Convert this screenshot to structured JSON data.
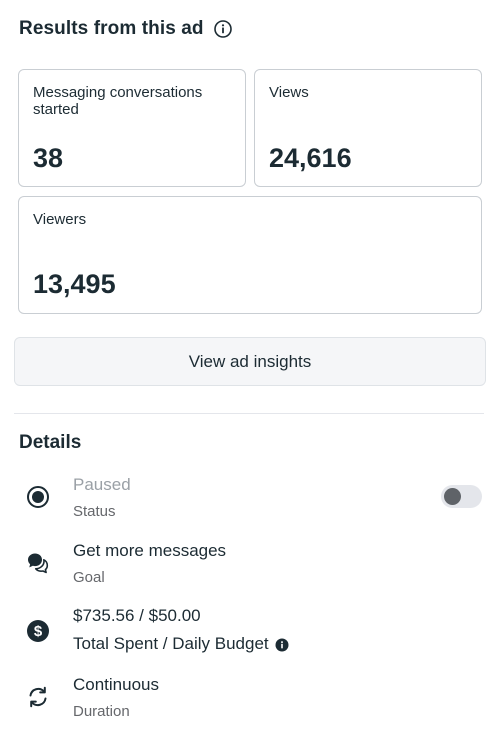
{
  "results": {
    "title": "Results from this ad",
    "cards": {
      "messaging": {
        "label": "Messaging conversations started",
        "value": "38"
      },
      "views": {
        "label": "Views",
        "value": "24,616"
      },
      "viewers": {
        "label": "Viewers",
        "value": "13,495"
      }
    },
    "insights_button_label": "View ad insights"
  },
  "details": {
    "title": "Details",
    "status": {
      "value": "Paused",
      "label": "Status",
      "icon": "radio-status-icon",
      "toggle_on": false
    },
    "goal": {
      "value": "Get more messages",
      "label": "Goal",
      "icon": "chat-bubbles-icon"
    },
    "budget": {
      "value": "$735.56 / $50.00",
      "label": "Total Spent / Daily Budget",
      "icon": "dollar-circle-icon",
      "info_icon": "info-icon"
    },
    "duration": {
      "value": "Continuous",
      "label": "Duration",
      "icon": "refresh-cycle-icon"
    }
  },
  "colors": {
    "text": "#1c2b33",
    "muted": "#9aa0a6",
    "secondary": "#65676b",
    "border": "#c9ced3"
  }
}
